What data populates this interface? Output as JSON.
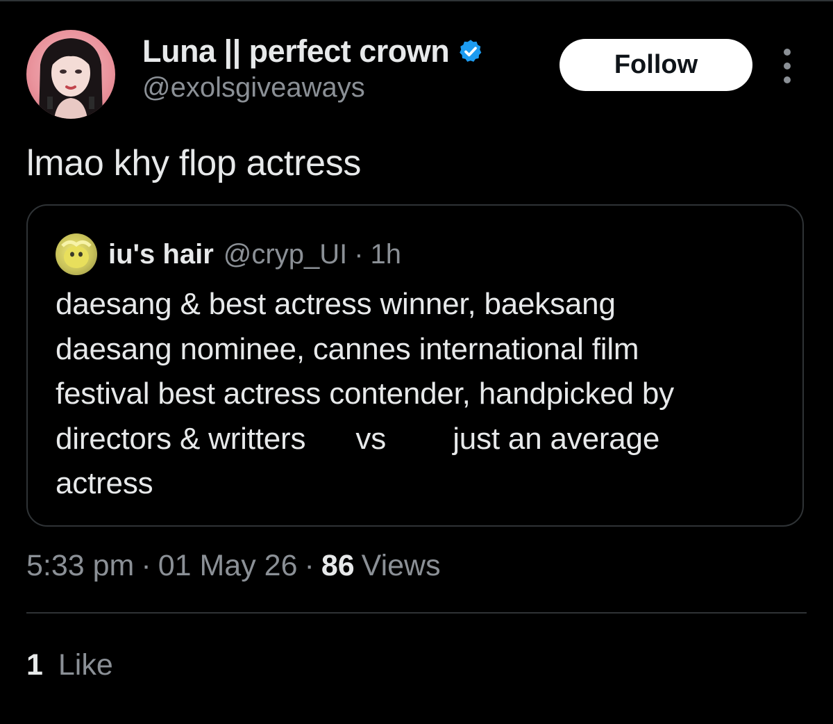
{
  "author": {
    "display_name": "Luna || perfect crown",
    "handle": "@exolsgiveaways",
    "verified": true,
    "avatar_icon": "user-avatar-photo"
  },
  "follow_button": {
    "label": "Follow"
  },
  "more_menu": {
    "icon": "more-dots-icon"
  },
  "tweet": {
    "text": "lmao khy flop actress"
  },
  "quoted_tweet": {
    "display_name": "iu's hair",
    "handle": "@cryp_UI",
    "separator": "·",
    "time": "1h",
    "body": "daesang & best actress winner, baeksang\ndaesang nominee, cannes international film\nfestival best actress contender, handpicked by\ndirectors & writters      vs        just an average\nactress",
    "avatar_icon": "quoted-user-avatar-photo"
  },
  "meta": {
    "time": "5:33 pm",
    "separator": "·",
    "date": "01 May 26",
    "views_count": "86",
    "views_label": "Views"
  },
  "engagement": {
    "likes_count": "1",
    "likes_label": "Like"
  },
  "colors": {
    "background": "#000000",
    "text_primary": "#e7e9ea",
    "text_secondary": "#8b9096",
    "border": "#2f3336",
    "verified_badge": "#1d9bf0",
    "follow_button_bg": "#ffffff"
  }
}
